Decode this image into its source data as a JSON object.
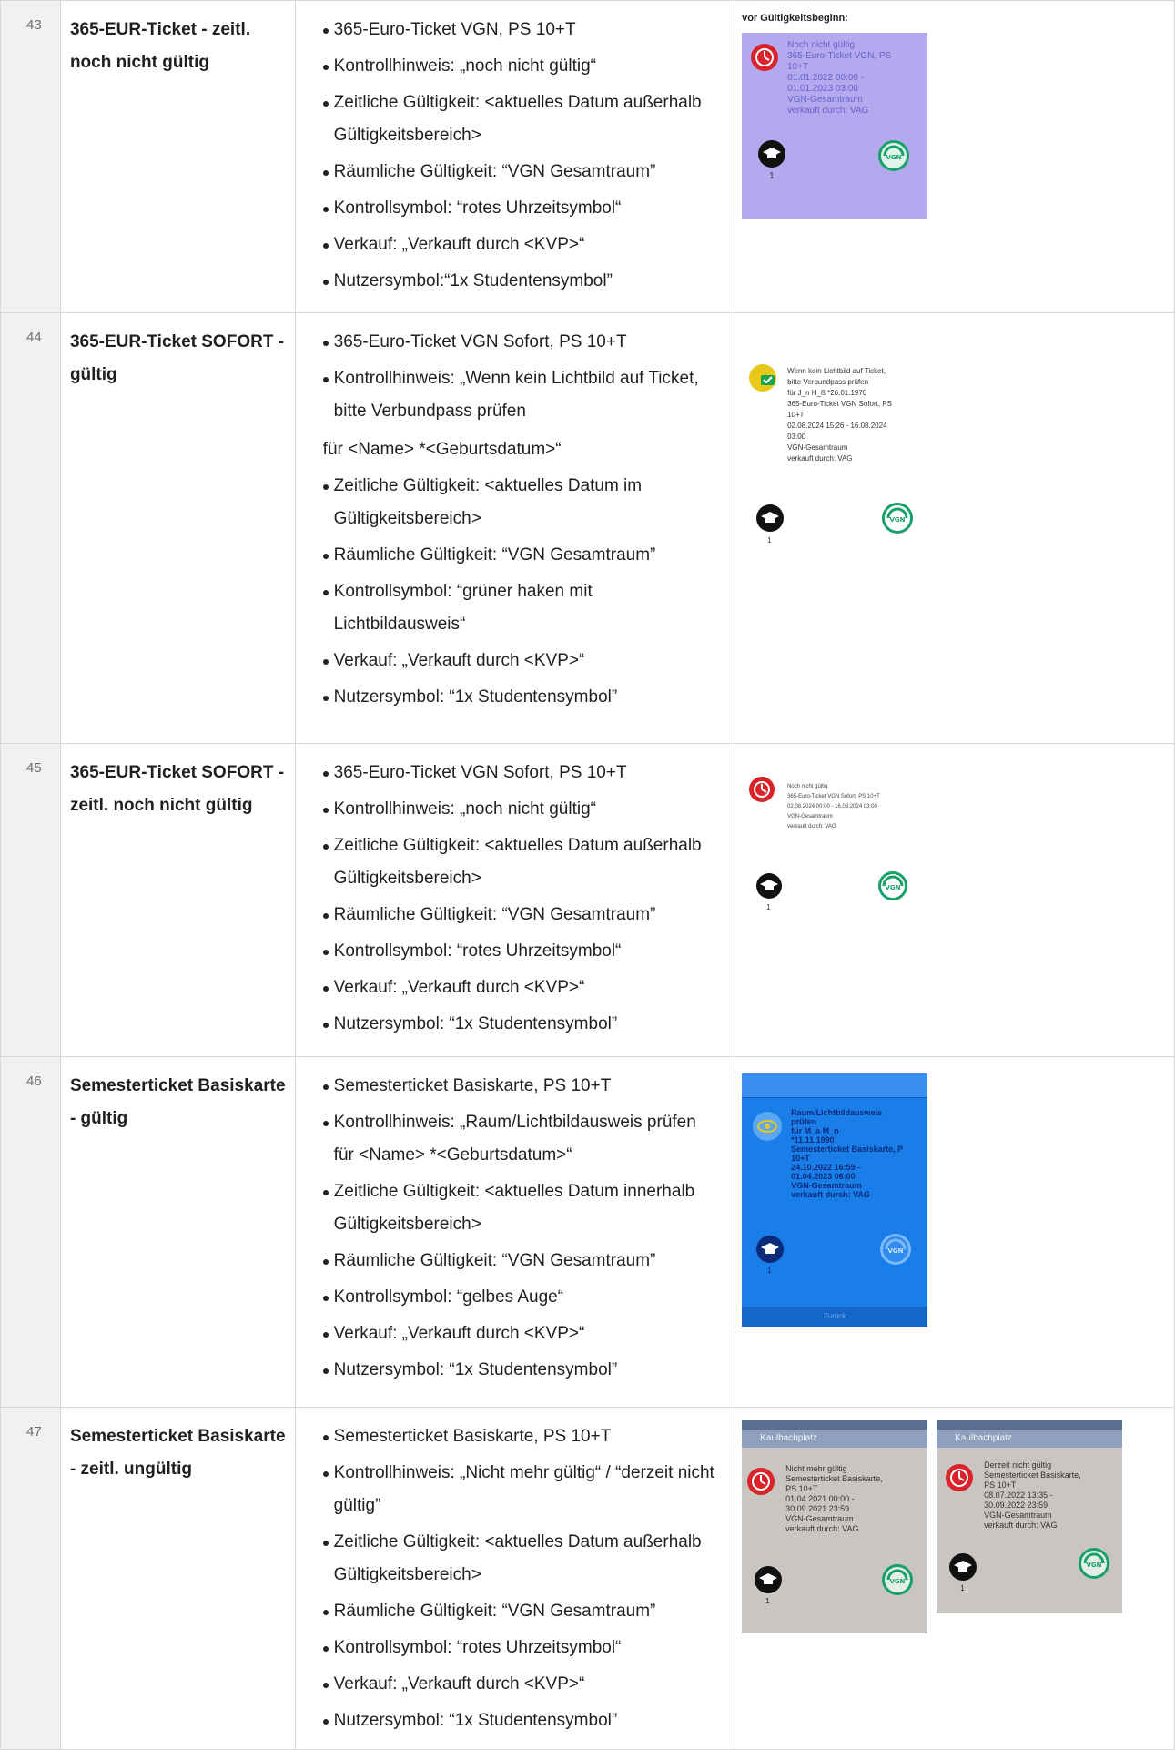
{
  "rows": [
    {
      "num": "43",
      "title": "365-EUR-Ticket - zeitl. noch nicht gültig",
      "details": [
        "365-Euro-Ticket VGN, PS 10+T",
        "Kontrollhinweis: „noch nicht gültig“",
        "Zeitliche Gültigkeit: <aktuelles Datum außerhalb Gültigkeitsbereich>",
        "Räumliche Gültigkeit: “VGN Gesamtraum”",
        "Kontrollsymbol: “rotes Uhrzeitsymbol“",
        "Verkauf: „Verkauft durch <KVP>“",
        "Nutzersymbol:“1x Studentensymbol”"
      ],
      "image_caption": "vor Gültigkeitsbeginn:",
      "screens": [
        {
          "lines": "Noch nicht gültig\n365-Euro-Ticket VGN, PS\n10+T\n01.01.2022 00:00 -\n01.01.2023 03:00\nVGN-Gesamtraum\nverkauft durch: VAG",
          "count": "1"
        }
      ]
    },
    {
      "num": "44",
      "title": "365-EUR-Ticket SOFORT - gültig",
      "details": [
        "365-Euro-Ticket VGN Sofort, PS 10+T",
        "Kontrollhinweis: „Wenn kein Lichtbild auf Ticket, bitte Verbundpass prüfen",
        "für <Name> *<Geburtsdatum>“",
        "Zeitliche Gültigkeit: <aktuelles Datum im Gültigkeitsbereich>",
        "Räumliche Gültigkeit: “VGN Gesamtraum”",
        "Kontrollsymbol: “grüner haken mit Lichtbildausweis“",
        "Verkauf: „Verkauft durch <KVP>“",
        "Nutzersymbol: “1x Studentensymbol”"
      ],
      "screens": [
        {
          "lines": "Wenn kein Lichtbild auf Ticket,\nbitte Verbundpass prüfen\nfür J_n H_ß *26.01.1970\n365-Euro-Ticket VGN Sofort, PS\n10+T\n02.08.2024 15:26 - 16.08.2024\n03:00\nVGN-Gesamtraum\nverkauft durch: VAG",
          "count": "1"
        }
      ]
    },
    {
      "num": "45",
      "title": "365-EUR-Ticket SOFORT - zeitl. noch nicht gültig",
      "details": [
        "365-Euro-Ticket VGN Sofort, PS 10+T",
        "Kontrollhinweis: „noch nicht gültig“",
        "Zeitliche Gültigkeit: <aktuelles Datum außerhalb Gültigkeitsbereich>",
        "Räumliche Gültigkeit: “VGN Gesamtraum”",
        "Kontrollsymbol: “rotes Uhrzeitsymbol“",
        "Verkauf: „Verkauft durch <KVP>“",
        "Nutzersymbol: “1x Studentensymbol”"
      ],
      "screens": [
        {
          "lines": "Noch nicht gültig\n365-Euro-Ticket VGN Sofort, PS 10+T\n02.08.2024 00:00 - 16.08.2024 03:00\nVGN-Gesamtraum\nverkauft durch: VAG",
          "count": "1"
        }
      ]
    },
    {
      "num": "46",
      "title": "Semesterticket Basiskarte - gültig",
      "details": [
        "Semesterticket Basiskarte, PS 10+T",
        "Kontrollhinweis: „Raum/Lichtbildausweis prüfen für <Name> *<Geburtsdatum>“",
        "Zeitliche Gültigkeit: <aktuelles Datum innerhalb Gültigkeitsbereich>",
        "Räumliche Gültigkeit: “VGN Gesamtraum”",
        "Kontrollsymbol: “gelbes Auge“",
        "Verkauf: „Verkauft durch <KVP>“",
        "Nutzersymbol: “1x Studentensymbol”"
      ],
      "screens": [
        {
          "lines": "Raum/Lichtbildausweis\nprüfen\nfür M_a M_n\n*11.11.1990\nSemesterticket Basiskarte, P\n10+T\n24.10.2022 16:59 -\n01.04.2023 06:00\nVGN-Gesamtraum\nverkauft durch: VAG",
          "count": "1",
          "footer": "Zurück"
        }
      ]
    },
    {
      "num": "47",
      "title": "Semesterticket Basiskarte - zeitl. ungültig",
      "details": [
        "Semesterticket Basiskarte, PS 10+T",
        "Kontrollhinweis: „Nicht mehr gültig“ / “derzeit nicht gültig”",
        "Zeitliche Gültigkeit: <aktuelles Datum außerhalb Gültigkeitsbereich>",
        "Räumliche Gültigkeit: “VGN Gesamtraum”",
        "Kontrollsymbol: “rotes Uhrzeitsymbol“",
        "Verkauf: „Verkauft durch <KVP>“",
        "Nutzersymbol: “1x Studentensymbol”"
      ],
      "screens": [
        {
          "header": "Kaulbachplatz",
          "lines": "Nicht mehr gültig\nSemesterticket Basiskarte,\nPS 10+T\n01.04.2021 00:00 -\n30.09.2021 23:59\nVGN-Gesamtraum\nverkauft durch: VAG",
          "count": "1"
        },
        {
          "header": "Kaulbachplatz",
          "lines": "Derzeit nicht gültig\nSemesterticket Basiskarte,\nPS 10+T\n08.07.2022 13:35 -\n30.09.2022 23:59\nVGN-Gesamtraum\nverkauft durch: VAG",
          "count": "1"
        }
      ]
    }
  ],
  "icons": {
    "clock": "red-clock-icon",
    "check": "green-check-id-icon",
    "eye": "yellow-eye-icon",
    "student": "student-cap-icon",
    "logo": "vgn-logo"
  },
  "colors": {
    "red": "#d9222a",
    "green": "#17a34a",
    "yellow": "#e8c81a",
    "purple_screen": "#b3a9ee",
    "blue_screen": "#1a7ee8",
    "grey_screen": "#c9c6c2"
  }
}
